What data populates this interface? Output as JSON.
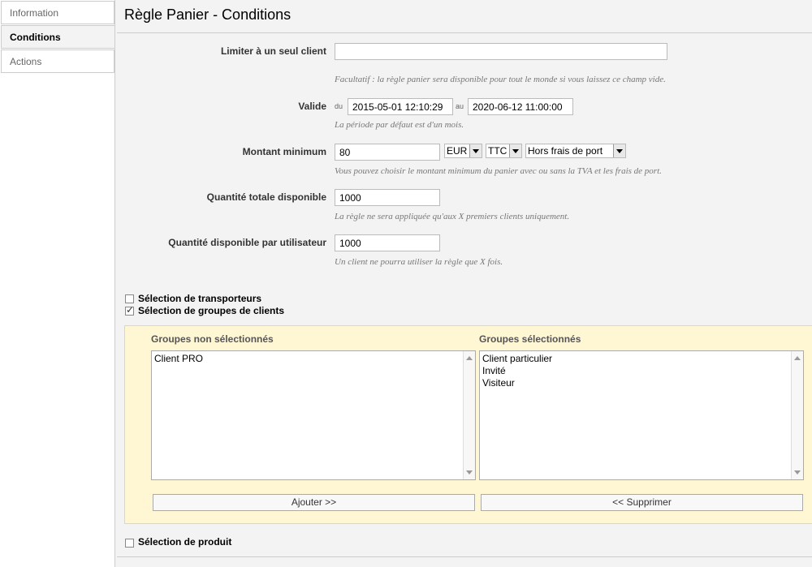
{
  "tabs": [
    {
      "label": "Information"
    },
    {
      "label": "Conditions"
    },
    {
      "label": "Actions"
    }
  ],
  "title": "Règle Panier - Conditions",
  "fields": {
    "client": {
      "label": "Limiter à un seul client",
      "value": "",
      "hint": "Facultatif : la règle panier sera disponible pour tout le monde si vous laissez ce champ vide."
    },
    "valid": {
      "label": "Valide",
      "from_prefix": "du",
      "from_value": "2015-05-01 12:10:29",
      "to_prefix": "au",
      "to_value": "2020-06-12 11:00:00",
      "hint": "La période par défaut est d'un mois."
    },
    "minimum": {
      "label": "Montant minimum",
      "value": "80",
      "currency": "EUR",
      "tax": "TTC",
      "shipping": "Hors frais de port",
      "hint": "Vous pouvez choisir le montant minimum du panier avec ou sans la TVA et les frais de port."
    },
    "total_qty": {
      "label": "Quantité totale disponible",
      "value": "1000",
      "hint": "La règle ne sera appliquée qu'aux X premiers clients uniquement."
    },
    "user_qty": {
      "label": "Quantité disponible par utilisateur",
      "value": "1000",
      "hint": "Un client ne pourra utiliser la règle que X fois."
    }
  },
  "checkboxes": {
    "carriers": {
      "label": "Sélection de transporteurs",
      "checked": false
    },
    "groups": {
      "label": "Sélection de groupes de clients",
      "checked": true
    },
    "products": {
      "label": "Sélection de produit",
      "checked": false
    }
  },
  "groups": {
    "unselected_title": "Groupes non sélectionnés",
    "unselected": [
      "Client PRO"
    ],
    "selected_title": "Groupes sélectionnés",
    "selected": [
      "Client particulier",
      "Invité",
      "Visiteur"
    ],
    "add_label": "Ajouter >>",
    "remove_label": "<< Supprimer"
  },
  "colors": {
    "panel_bg": "#f3f3f3",
    "group_box_bg": "#fff6d3"
  }
}
